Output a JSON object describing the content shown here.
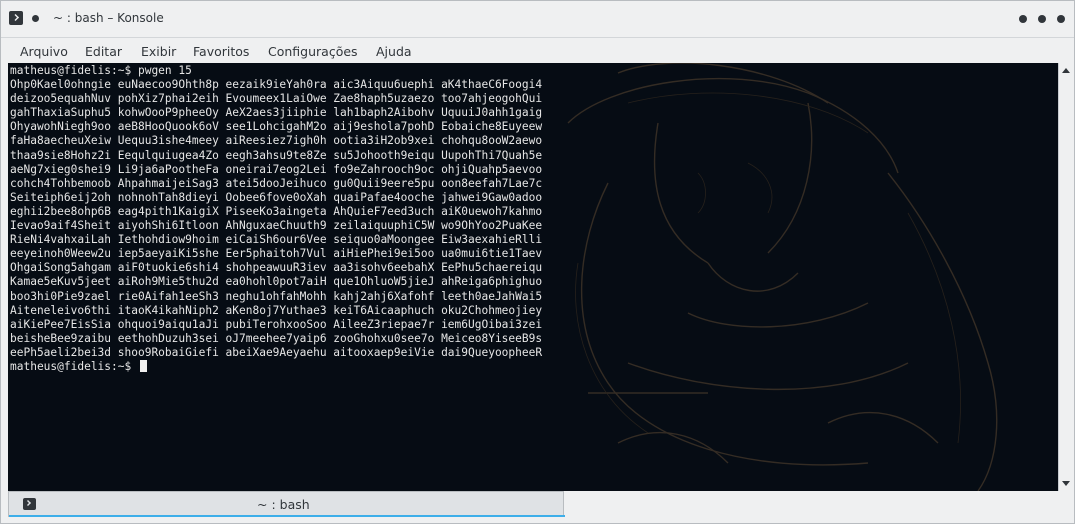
{
  "window": {
    "title": "~ : bash – Konsole"
  },
  "menu": {
    "items": [
      "Arquivo",
      "Editar",
      "Exibir",
      "Favoritos",
      "Configurações",
      "Ajuda"
    ]
  },
  "terminal": {
    "lines": [
      "matheus@fidelis:~$ pwgen 15",
      "Ohp0Kael0ohngie euNaecoo9Ohth8p eezaik9ieYah0ra aic3Aiquu6uephi aK4thaeC6Foogi4",
      "deizoo5equahNuv pohXiz7phai2eih Evoumeex1LaiOwe Zae8haph5uzaezo too7ahjeogohQui",
      "gahThaxiaSuphu5 kohwOooP9pheeOy AeX2aes3jiiphie lah1baph2Aibohv UquuiJ0ahh1gaig",
      "OhyawohNiegh9oo aeB8HooQuook6oV see1LohcigahM2o aij9eshola7pohD Eobaiche8Euyeew",
      "faHa8aecheuXeiw Uequu3ishe4meey aiReesiez7igh0h ootia3iH2ob9xei chohqu8ooW2aewo",
      "thaa9sie8Hohz2i Eequlquiugea4Zo eegh3ahsu9te8Ze su5Johooth9eiqu UupohThi7Quah5e",
      "aeNg7xieg0shei9 Li9ja6aPootheFa oneirai7eog2Lei fo9eZahrooch9oc ohjiQuahp5aevoo",
      "cohch4Tohbemoob AhpahmaijeiSag3 atei5dooJeihuco gu0Quii9eere5pu oon8eefah7Lae7c",
      "Seiteiph6eij2oh nohnohTah8dieyi Oobee6fove0oXah quaiPafae4ooche jahwei9Gaw0adoo",
      "eghii2bee8ohp6B eag4pith1KaigiX PiseeKo3aingeta AhQuieF7eed3uch aiK0uewoh7kahmo",
      "Ievao9aif4Sheit aiyohShi6Itloon AhNguxaeChuuth9 zeilaiquuphiC5W wo9OhYoo2PuaKee",
      "RieNi4vahxaiLah Iethohdiow9hoim eiCaiSh6our6Vee seiquo0aMoongee Eiw3aexahieRlli",
      "eeyeinoh0Weew2u iep5aeyaiKi5she Eer5phaitoh7Vul aiHiePhei9ei5oo ua0mui6tie1Taev",
      "OhgaiSong5ahgam aiF0tuokie6shi4 shohpeawuuR3iev aa3isohv6eebahX EePhu5chaereiqu",
      "Kamae5eKuv5jeet aiRoh9Mie5thu2d ea0hohl0pot7aiH que1OhluoW5jieJ ahReiga6phighuo",
      "boo3hi0Pie9zael rie0Aifah1eeSh3 neghu1ohfahMohh kahj2ahj6Xafohf leeth0aeJahWai5",
      "Aiteneleivo6thi itaoK4ikahNiph2 aKen8oj7Yuthae3 keiT6Aicaaphuch oku2Chohmeojiey",
      "aiKiePee7EisSia ohquoi9aiqu1aJi pubiTerohxooSoo AileeZ3riepae7r iem6UgOibai3zei",
      "beisheBee9zaibu eethohDuzuh3sei oJ7meehee7yaip6 zooGhohxu0see7o Meiceo8YiseeB9s",
      "eePh5aeli2bei3d shoo9RobaiGiefi abeiXae9Aeyaehu aitooxaep9eiVie dai9QueyoopheeR",
      "matheus@fidelis:~$ "
    ]
  },
  "tabs": [
    {
      "label": "~ : bash"
    }
  ],
  "icons": {
    "app": "konsole-icon",
    "tab": "terminal-icon"
  },
  "colors": {
    "terminal_bg": "#060c14",
    "terminal_fg": "#e6e6e6",
    "window_bg": "#eff0f1",
    "accent": "#3daee9"
  }
}
